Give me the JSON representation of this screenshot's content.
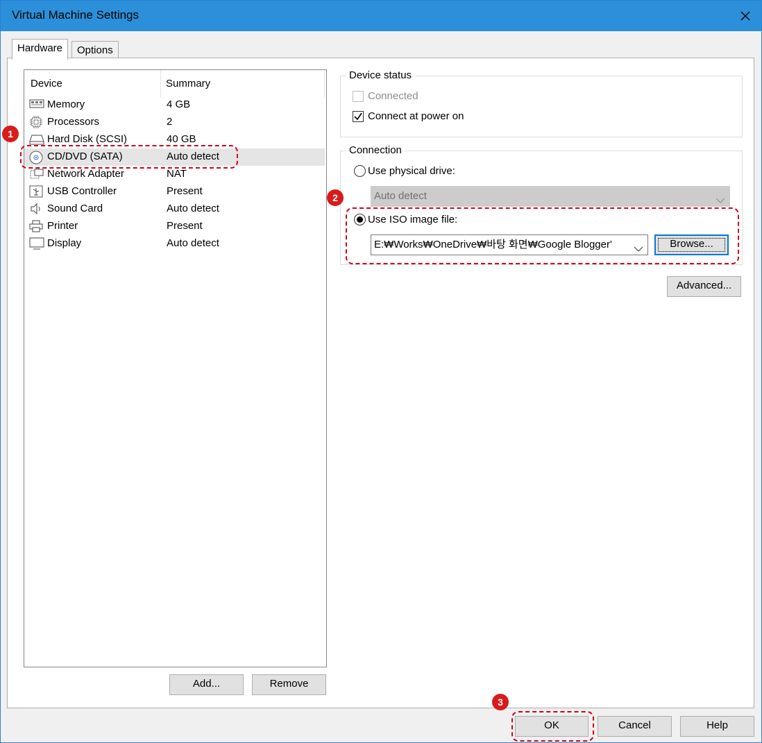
{
  "window": {
    "title": "Virtual Machine Settings"
  },
  "tabs": [
    {
      "label": "Hardware",
      "active": true
    },
    {
      "label": "Options",
      "active": false
    }
  ],
  "device_list": {
    "columns": [
      "Device",
      "Summary"
    ],
    "rows": [
      {
        "name": "Memory",
        "summary": "4 GB",
        "icon": "memory-icon"
      },
      {
        "name": "Processors",
        "summary": "2",
        "icon": "processor-icon"
      },
      {
        "name": "Hard Disk (SCSI)",
        "summary": "40 GB",
        "icon": "hard-disk-icon"
      },
      {
        "name": "CD/DVD (SATA)",
        "summary": "Auto detect",
        "icon": "cd-dvd-icon",
        "selected": true
      },
      {
        "name": "Network Adapter",
        "summary": "NAT",
        "icon": "network-adapter-icon"
      },
      {
        "name": "USB Controller",
        "summary": "Present",
        "icon": "usb-icon"
      },
      {
        "name": "Sound Card",
        "summary": "Auto detect",
        "icon": "sound-card-icon"
      },
      {
        "name": "Printer",
        "summary": "Present",
        "icon": "printer-icon"
      },
      {
        "name": "Display",
        "summary": "Auto detect",
        "icon": "display-icon"
      }
    ]
  },
  "list_buttons": {
    "add": "Add...",
    "remove": "Remove"
  },
  "device_status": {
    "legend": "Device status",
    "connected_label": "Connected",
    "connected_checked": false,
    "connected_enabled": false,
    "power_on_label": "Connect at power on",
    "power_on_checked": true
  },
  "connection": {
    "legend": "Connection",
    "physical_label": "Use physical drive:",
    "physical_value": "Auto detect",
    "iso_label": "Use ISO image file:",
    "iso_value": "E:₩Works₩OneDrive₩바탕 화면₩Google Blogger'",
    "browse_label": "Browse...",
    "selected": "iso"
  },
  "advanced_label": "Advanced...",
  "footer": {
    "ok": "OK",
    "cancel": "Cancel",
    "help": "Help"
  },
  "annotations": [
    "1",
    "2",
    "3"
  ],
  "colors": {
    "titlebar": "#2b90d9",
    "highlight": "#d0021b",
    "focus": "#0078d7"
  }
}
